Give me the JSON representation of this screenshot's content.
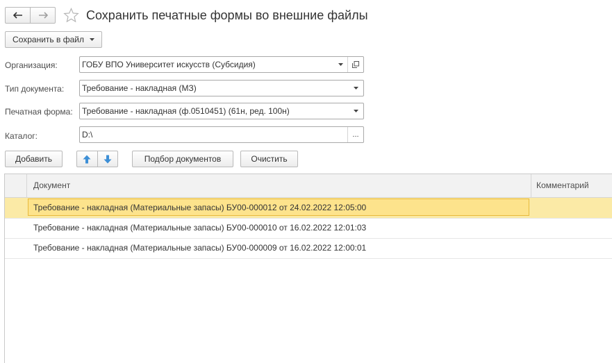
{
  "window": {
    "title": "Сохранить печатные формы во внешние файлы",
    "back_icon": "arrow-left-icon",
    "forward_icon": "arrow-right-icon",
    "favorite_icon": "star-icon"
  },
  "toolbar": {
    "save_to_file_label": "Сохранить в файл"
  },
  "form": {
    "organization_label": "Организация:",
    "organization_value": "ГОБУ ВПО Университет искусств (Субсидия)",
    "doc_type_label": "Тип документа:",
    "doc_type_value": "Требование - накладная (МЗ)",
    "print_form_label": "Печатная форма:",
    "print_form_value": "Требование - накладная (ф.0510451) (61н, ред. 100н)",
    "catalog_label": "Каталог:",
    "catalog_value": "D:\\",
    "catalog_browse": "..."
  },
  "actions": {
    "add_label": "Добавить",
    "select_docs_label": "Подбор документов",
    "clear_label": "Очистить"
  },
  "table": {
    "columns": [
      "Документ",
      "Комментарий"
    ],
    "rows": [
      {
        "document": "Требование - накладная (Материальные запасы) БУ00-000012 от 24.02.2022 12:05:00",
        "comment": ""
      },
      {
        "document": "Требование - накладная (Материальные запасы) БУ00-000010 от 16.02.2022 12:01:03",
        "comment": ""
      },
      {
        "document": "Требование - накладная (Материальные запасы) БУ00-000009 от 16.02.2022 12:00:01",
        "comment": ""
      }
    ]
  },
  "colors": {
    "selected_row": "#fbeaa6",
    "selected_cell_border": "#e7b93c",
    "arrow_blue": "#3d8fd6"
  }
}
